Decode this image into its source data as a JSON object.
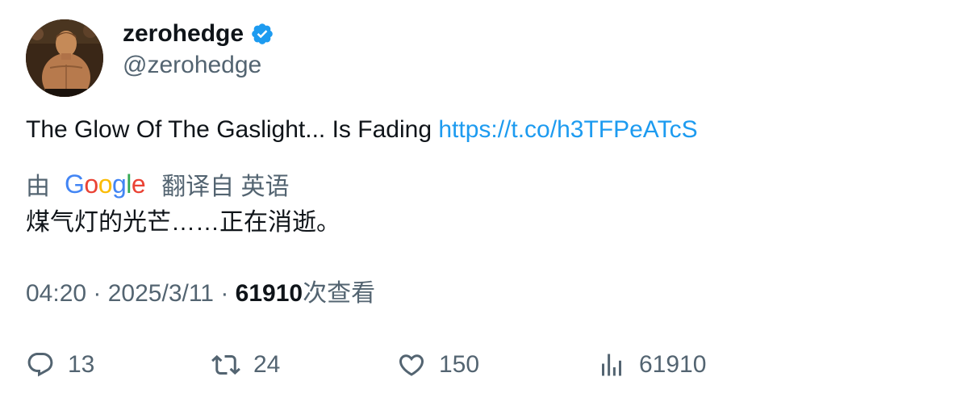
{
  "author": {
    "name": "zerohedge",
    "handle": "@zerohedge",
    "verified": true
  },
  "tweet": {
    "text": "The Glow Of The Gaslight... Is Fading ",
    "link": "https://t.co/h3TFPeATcS"
  },
  "translation": {
    "by_label": "由",
    "provider_letters": [
      "G",
      "o",
      "o",
      "g",
      "l",
      "e"
    ],
    "from_label": "翻译自 英语",
    "text": "煤气灯的光芒……正在消逝。"
  },
  "meta": {
    "time": "04:20",
    "separator": " · ",
    "date": "2025/3/11",
    "views": "61910",
    "views_suffix": "次查看"
  },
  "actions": {
    "replies": "13",
    "retweets": "24",
    "likes": "150",
    "views": "61910"
  },
  "colors": {
    "accent": "#1d9bf0",
    "text": "#0f1419",
    "secondary": "#536471"
  }
}
